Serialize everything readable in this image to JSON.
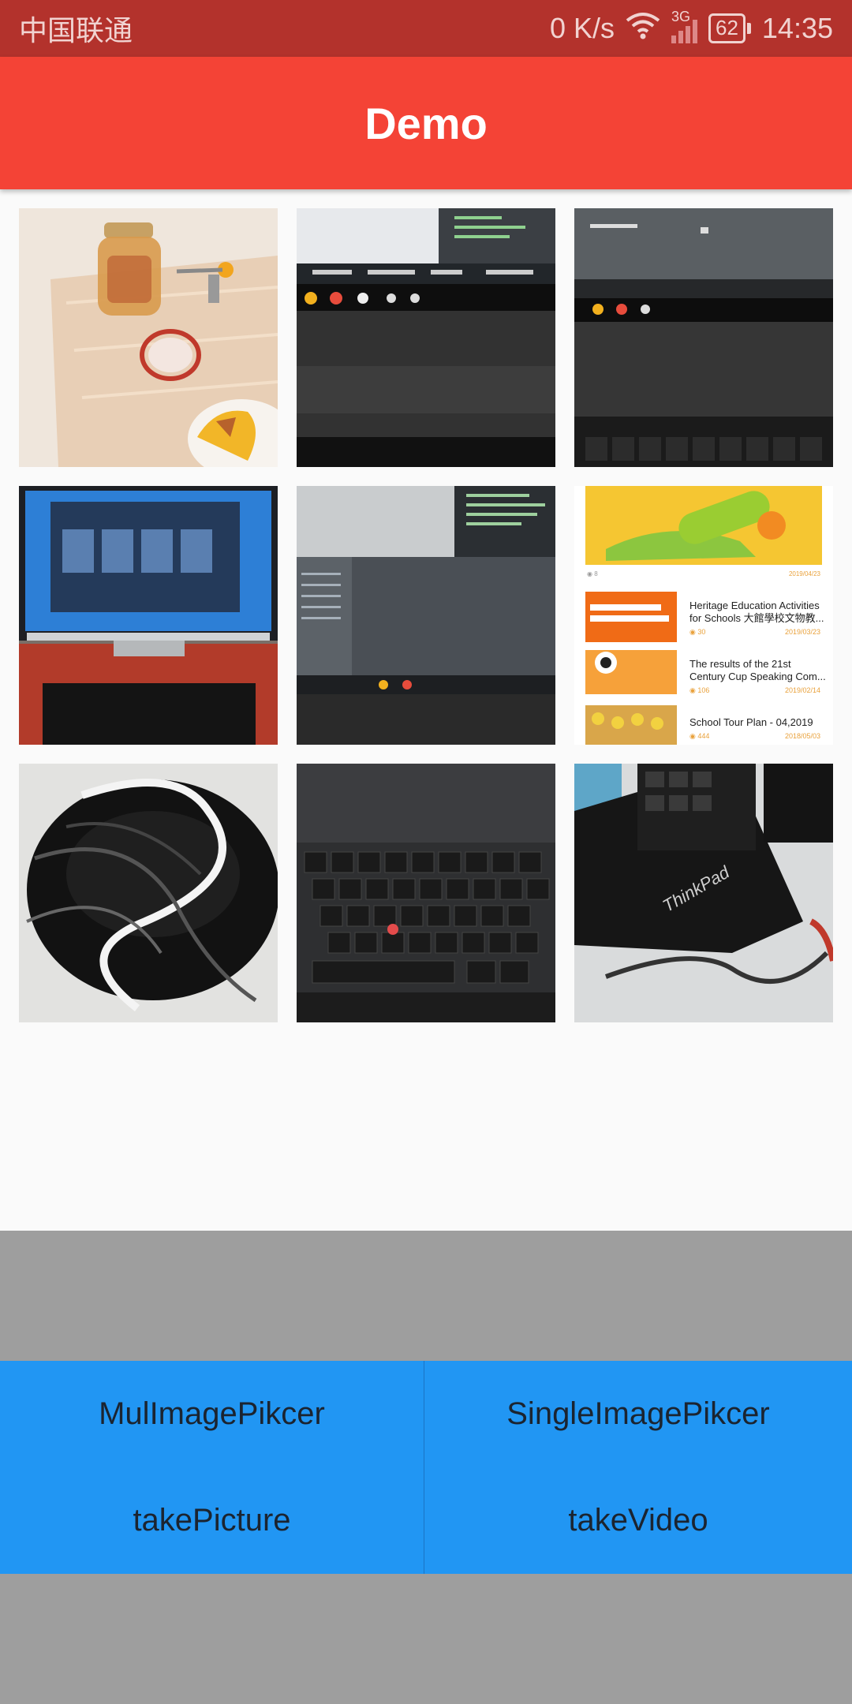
{
  "status_bar": {
    "carrier": "中国联通",
    "speed": "0 K/s",
    "network": "3G",
    "battery": "62",
    "time": "14:35"
  },
  "app_bar": {
    "title": "Demo"
  },
  "gallery": {
    "images": [
      {
        "name": "jar-keys-food-photo"
      },
      {
        "name": "laptop-screen-ide-photo"
      },
      {
        "name": "laptop-keyboard-screen-photo"
      },
      {
        "name": "monitor-desktop-photo"
      },
      {
        "name": "laptop-ide-closeup-photo"
      },
      {
        "name": "news-feed-screenshot"
      },
      {
        "name": "black-cables-photo"
      },
      {
        "name": "thinkpad-keyboard-photo"
      },
      {
        "name": "thinkpad-lid-photo"
      }
    ],
    "news_feed": {
      "item1_title": "Heritage Education Activities for Schools 大館學校文物教...",
      "item1_date": "2019/03/23",
      "item1_views": "30",
      "item2_title": "The results of the 21st Century Cup Speaking Com...",
      "item2_date": "2019/02/14",
      "item2_views": "106",
      "item3_title": "School Tour Plan - 04,2019",
      "item3_date": "2018/05/03",
      "item3_views": "444",
      "top_date": "2019/04/23"
    }
  },
  "buttons": {
    "mul_image_picker": "MulImagePikcer",
    "single_image_picker": "SingleImagePikcer",
    "take_picture": "takePicture",
    "take_video": "takeVideo"
  },
  "colors": {
    "status_bar": "#b3322c",
    "app_bar": "#f44336",
    "button_panel": "#2196f3",
    "bottom_gray": "#9e9e9e"
  }
}
